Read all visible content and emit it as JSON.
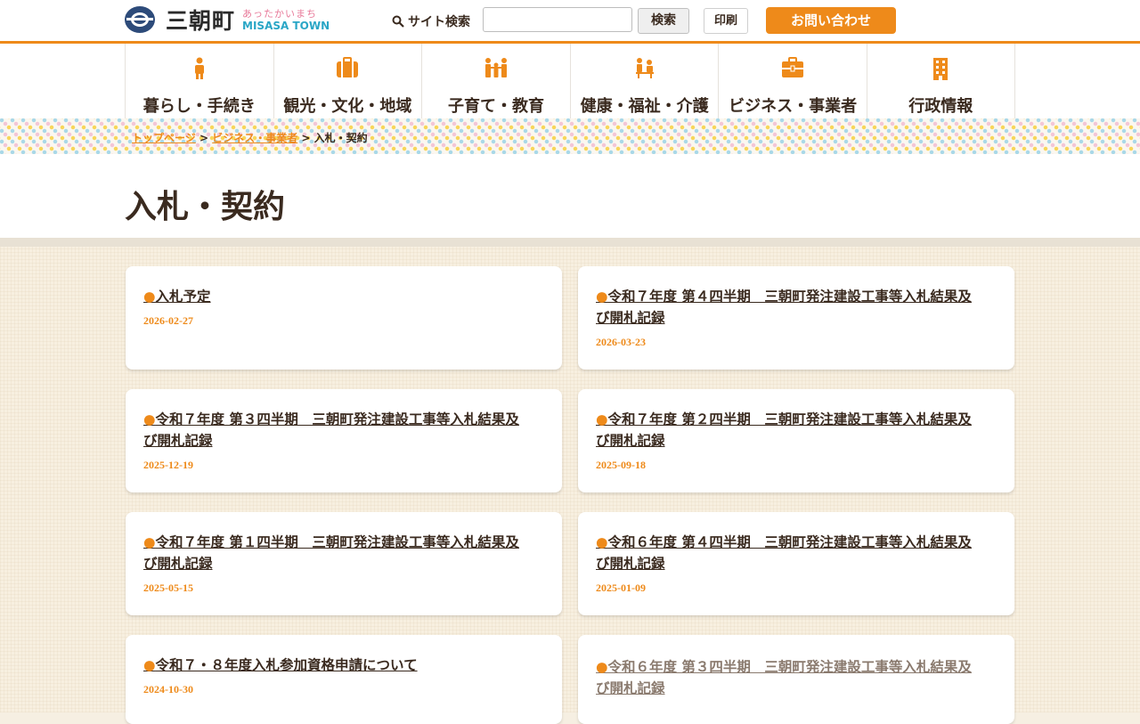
{
  "header": {
    "logo_name": "三朝町",
    "logo_sub_hira": "あったかいまち",
    "logo_sub_en": "MISASA TOWN",
    "search_label": "サイト検索",
    "search_placeholder": "",
    "search_button": "検索",
    "print_button": "印刷",
    "contact_button": "お問い合わせ"
  },
  "nav": [
    {
      "label": "暮らし・手続き",
      "icon": "person-icon"
    },
    {
      "label": "観光・文化・地域",
      "icon": "suitcase-icon"
    },
    {
      "label": "子育て・教育",
      "icon": "family-icon"
    },
    {
      "label": "健康・福祉・介護",
      "icon": "care-icon"
    },
    {
      "label": "ビジネス・事業者",
      "icon": "briefcase-icon"
    },
    {
      "label": "行政情報",
      "icon": "building-icon"
    }
  ],
  "breadcrumb": {
    "items": [
      "トップページ",
      "ビジネス・事業者"
    ],
    "separator": ">",
    "current": "入札・契約"
  },
  "page_title": "入札・契約",
  "cards": [
    {
      "bullet": "●",
      "title": "入札予定",
      "date": "2026-02-27"
    },
    {
      "bullet": "●",
      "title": "令和７年度 第４四半期　三朝町発注建設工事等入札結果及び開札記録",
      "date": "2026-03-23"
    },
    {
      "bullet": "●",
      "title": "令和７年度 第３四半期　三朝町発注建設工事等入札結果及び開札記録",
      "date": "2025-12-19"
    },
    {
      "bullet": "●",
      "title": "令和７年度 第２四半期　三朝町発注建設工事等入札結果及び開札記録",
      "date": "2025-09-18"
    },
    {
      "bullet": "●",
      "title": "令和７年度 第１四半期　三朝町発注建設工事等入札結果及び開札記録",
      "date": "2025-05-15"
    },
    {
      "bullet": "●",
      "title": "令和６年度 第４四半期　三朝町発注建設工事等入札結果及び開札記録",
      "date": "2025-01-09"
    },
    {
      "bullet": "●",
      "title": "令和７・８年度入札参加資格申請について",
      "date": "2024-10-30"
    },
    {
      "bullet": "●",
      "title": "令和６年度 第３四半期　三朝町発注建設工事等入札結果及び開札記録",
      "date": ""
    }
  ],
  "colors": {
    "accent": "#ee8a1a",
    "text": "#3a2a1f"
  }
}
